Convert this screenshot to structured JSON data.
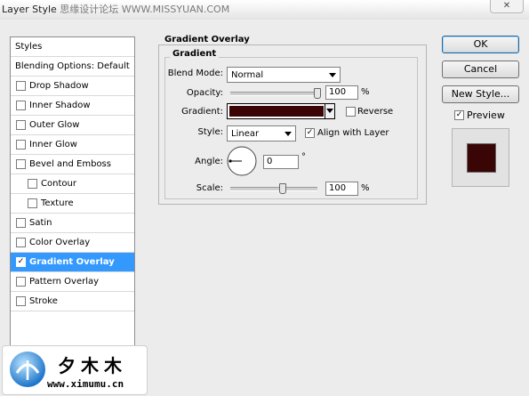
{
  "window": {
    "title": "Layer Style",
    "watermark": "思缘设计论坛 WWW.MISSYUAN.COM",
    "close_label": "✕"
  },
  "styles_list": {
    "header": "Styles",
    "blending": "Blending Options: Default",
    "items": [
      {
        "label": "Drop Shadow",
        "checked": false
      },
      {
        "label": "Inner Shadow",
        "checked": false
      },
      {
        "label": "Outer Glow",
        "checked": false
      },
      {
        "label": "Inner Glow",
        "checked": false
      },
      {
        "label": "Bevel and Emboss",
        "checked": false
      },
      {
        "label": "Contour",
        "checked": false
      },
      {
        "label": "Texture",
        "checked": false
      },
      {
        "label": "Satin",
        "checked": false
      },
      {
        "label": "Color Overlay",
        "checked": false
      },
      {
        "label": "Gradient Overlay",
        "checked": true,
        "selected": true
      },
      {
        "label": "Pattern Overlay",
        "checked": false
      },
      {
        "label": "Stroke",
        "checked": false
      }
    ]
  },
  "gradient_overlay": {
    "section_title": "Gradient Overlay",
    "group_title": "Gradient",
    "blend_mode_label": "Blend Mode:",
    "blend_mode_value": "Normal",
    "opacity_label": "Opacity:",
    "opacity_value": "100",
    "opacity_fraction": 1.0,
    "opacity_unit": "%",
    "gradient_label": "Gradient:",
    "gradient_color": "#3a0505",
    "reverse_label": "Reverse",
    "reverse_checked": false,
    "style_label": "Style:",
    "style_value": "Linear",
    "align_label": "Align with Layer",
    "align_checked": true,
    "angle_label": "Angle:",
    "angle_value": "0",
    "angle_unit": "°",
    "scale_label": "Scale:",
    "scale_value": "100",
    "scale_fraction": 0.6,
    "scale_unit": "%"
  },
  "buttons": {
    "ok": "OK",
    "cancel": "Cancel",
    "new_style": "New Style..."
  },
  "preview": {
    "label": "Preview",
    "checked": true,
    "swatch_color": "#3a0505"
  },
  "logo": {
    "name": "夕木木",
    "url": "www.ximumu.cn"
  },
  "colors": {
    "selection": "#3399ff",
    "dialog_bg": "#ececec"
  }
}
